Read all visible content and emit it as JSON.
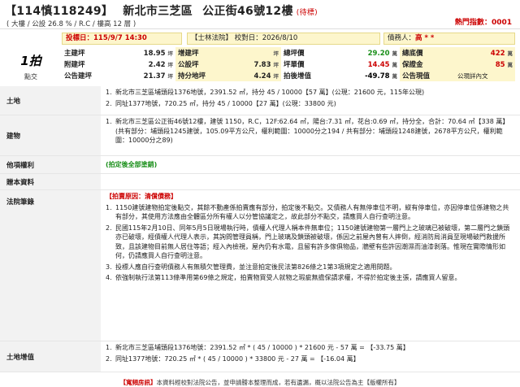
{
  "header": {
    "case_no": "【114慎118249】",
    "location": "新北市三芝區",
    "address": "公正街46號12樓",
    "status": "(待標)",
    "summary": "( 大樓 / 公設 26.8 % / R.C / 樓高 12 層 )",
    "heat_label": "熱門指數：",
    "heat_value": "0001"
  },
  "bars": {
    "auction_date": "投標日：115/9/7 14:30",
    "court": "【士林法院】 校對日：2026/8/10",
    "debtor_label": "債務人：",
    "debtor_value": "高 * *"
  },
  "badge": {
    "round": "1拍",
    "type": "點交"
  },
  "auction": {
    "rows": [
      [
        "主建坪",
        "18.95",
        "增建坪",
        "",
        "總坪價",
        "29.20",
        "總底價",
        "422"
      ],
      [
        "附建坪",
        "2.42",
        "公設坪",
        "7.83",
        "坪單價",
        "14.45",
        "保證金",
        "85"
      ],
      [
        "公告建坪",
        "21.37",
        "持分地坪",
        "4.24",
        "拍後增值",
        "-49.78",
        "公告現值",
        "公現詳內文"
      ]
    ],
    "units": [
      "坪",
      "坪",
      "坪",
      "萬",
      "萬",
      "萬",
      "萬"
    ]
  },
  "land": {
    "label": "土地",
    "items": [
      "新北市三芝區埔頭段1376地號，2391.52 ㎡，持分 45 / 10000【57 萬】(公現：21600 元，115年公現)",
      "同址1377地號，720.25 ㎡，持分 45 / 10000【27 萬】(公現：33800 元)"
    ]
  },
  "building": {
    "label": "建物",
    "item": "新北市三芝區公正街46號12樓，建號 1150，R.C，12F:62.64 ㎡，陽台:7.31 ㎡，花台:0.69 ㎡，持分全，合計：70.64 ㎡【338 萬】(共有部分：埔頭段1245建號，105.09平方公尺，權利範圍：10000分之194 / 共有部分：埔頭段1248建號，2678平方公尺，權利範圍：10000分之89)"
  },
  "other_rights": {
    "label": "他項權利",
    "value": "(拍定後全部塗銷)"
  },
  "gift_data": {
    "label": "贈本資料",
    "value": ""
  },
  "legal": {
    "label": "法院筆錄",
    "head": "【拍賣原因：清償債務】",
    "items": [
      "1150建號建物拍定後點交，其餘不動產係拍賣應有部分，拍定後不點交。又債務人有無停車位不明，縱有停車位，亦因停車位係建物之共有部分，其使用方法應由全體區分所有權人以分管協議定之，故此部分不點交，請應買人自行查明注意。",
      "民國115年2月10日、同年5月5日現場執行時，債權人代理人稱本件無車位；1150建號建物第一層門上之玻璃已被破壞，第二層門之鎖頭亦已破壞，經債權人代理人表示，其詢問管理員稱，門上玻璃及鎖頭被破壞，係因之前屋內曾有人摔倒，經消防局消員至現場破門救援所致，且該建物目前無人居住等語；經入內檢視，屋內仍有水電，且留有許多傢俱物品，牆壁有些許因潮濕而油漆剝落。惟現在實際情形如何，仍請應買人自行查明注意。",
      "投標人應自行查明債務人有無積欠管理費，並注意拍定後民法第826條之1第3項規定之適用問題。",
      "依強制執行法第113條準用第69條之規定，拍賣物買受人就物之瑕疵無擔保請求權，不得於拍定後主張，請應買人留意。"
    ]
  },
  "land_value": {
    "label": "土地增值",
    "items": [
      "新北市三芝區埔頭段1376地號：2391.52 ㎡ * ( 45 / 10000 ) * 21600 元 - 57 萬 = 【-33.75 萬】",
      "同址1377地號：720.25 ㎡ * ( 45 / 10000 ) * 33800 元 - 27 萬 = 【-16.04 萬】"
    ]
  },
  "footer": {
    "tag": "【寬頻房訊】",
    "text": "本資料經校對法院公告，並申請謄本整理而成，若有遺漏，概以法院公告為主【版權所有】"
  }
}
